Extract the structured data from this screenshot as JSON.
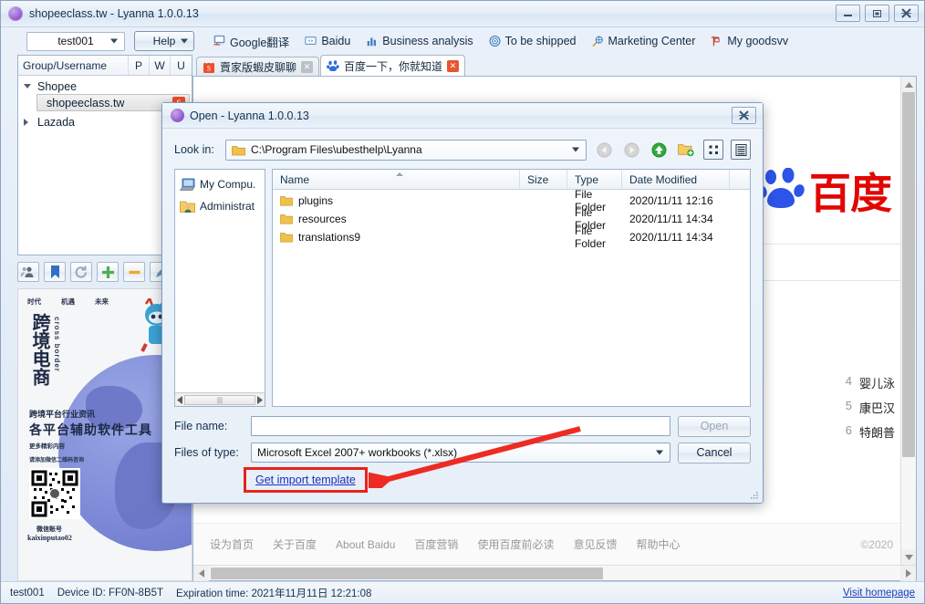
{
  "window": {
    "title": "shopeeclass.tw - Lyanna 1.0.0.13",
    "logo_icon": "app-logo-icon",
    "controls": {
      "minimize": "minimize-icon",
      "maximize": "maximize-icon",
      "close": "close-icon"
    }
  },
  "toolbar": {
    "account": "test001",
    "help": "Help",
    "links": [
      {
        "label": "Google翻译",
        "icon": "monitor-icon"
      },
      {
        "label": "Baidu",
        "icon": "browser-icon"
      },
      {
        "label": "Business analysis",
        "icon": "bar-chart-icon"
      },
      {
        "label": "To be shipped",
        "icon": "target-icon"
      },
      {
        "label": "Marketing Center",
        "icon": "megaphone-icon"
      },
      {
        "label": "My goodsvv",
        "icon": "flag-icon"
      }
    ]
  },
  "tree": {
    "columns": [
      "Group/Username",
      "P",
      "W",
      "U"
    ],
    "nodes": [
      {
        "label": "Shopee",
        "expanded": true,
        "level": 0
      },
      {
        "label": "shopeeclass.tw",
        "selected": true,
        "level": 1,
        "badge": "S"
      },
      {
        "label": "Lazada",
        "expanded": false,
        "level": 0
      }
    ],
    "tools": [
      {
        "name": "add-contact-icon"
      },
      {
        "name": "bookmark-icon"
      },
      {
        "name": "refresh-icon"
      },
      {
        "name": "add-icon"
      },
      {
        "name": "remove-icon"
      },
      {
        "name": "edit-icon"
      }
    ]
  },
  "ad_panel": {
    "top_words": [
      "时代",
      "机遇",
      "未来"
    ],
    "big_text": "跨境电商",
    "vertical_text": "cross border",
    "line1": "跨境平台行业资讯",
    "line2": "各平台辅助软件工具",
    "line3": "更多精彩内容",
    "line4": "请添加微信二维码咨询",
    "qr_label": "微信账号",
    "qr_id": "kaixinputao02"
  },
  "browser": {
    "tabs": [
      {
        "label": "賣家版蝦皮聊聊",
        "active": false,
        "icon": "shopee-icon",
        "close": "close-icon"
      },
      {
        "label": "百度一下，你就知道",
        "active": true,
        "icon": "baidu-icon",
        "close": "close-icon"
      }
    ],
    "page": {
      "logo_text": "百度",
      "hot_items": [
        {
          "rank": "4",
          "text": "婴儿泳"
        },
        {
          "rank": "5",
          "text": "康巴汉"
        },
        {
          "rank": "6",
          "text": "特朗普"
        }
      ],
      "footer_links": [
        "设为首页",
        "关于百度",
        "About Baidu",
        "百度营销",
        "使用百度前必读",
        "意见反馈",
        "帮助中心"
      ],
      "copyright": "©2020"
    }
  },
  "status": {
    "user": "test001",
    "device": "Device ID: FF0N-8B5T",
    "expiration": "Expiration time: 2021年11月11日 12:21:08",
    "homepage_link": "Visit homepage"
  },
  "dialog": {
    "title": "Open - Lyanna 1.0.0.13",
    "close_icon": "close-icon",
    "lookin_label": "Look in:",
    "lookin_value": "C:\\Program Files\\ubesthelp\\Lyanna",
    "nav_icons": [
      "back-icon",
      "forward-icon",
      "up-icon",
      "new-folder-icon",
      "list-view-icon",
      "detail-view-icon"
    ],
    "places": [
      {
        "label": "My Compu.",
        "icon": "computer-icon"
      },
      {
        "label": "Administrat",
        "icon": "user-folder-icon"
      }
    ],
    "columns": [
      "Name",
      "Size",
      "Type",
      "Date Modified"
    ],
    "files": [
      {
        "name": "plugins",
        "size": "",
        "type": "File Folder",
        "date": "2020/11/11 12:16",
        "icon": "folder-icon"
      },
      {
        "name": "resources",
        "size": "",
        "type": "File Folder",
        "date": "2020/11/11 14:34",
        "icon": "folder-icon"
      },
      {
        "name": "translations9",
        "size": "",
        "type": "File Folder",
        "date": "2020/11/11 14:34",
        "icon": "folder-icon"
      }
    ],
    "filename_label": "File name:",
    "filename_value": "",
    "filetype_label": "Files of type:",
    "filetype_value": "Microsoft Excel 2007+ workbooks (*.xlsx)",
    "open_button": "Open",
    "cancel_button": "Cancel",
    "template_link": "Get import template",
    "highlight_color": "#e8221c"
  }
}
